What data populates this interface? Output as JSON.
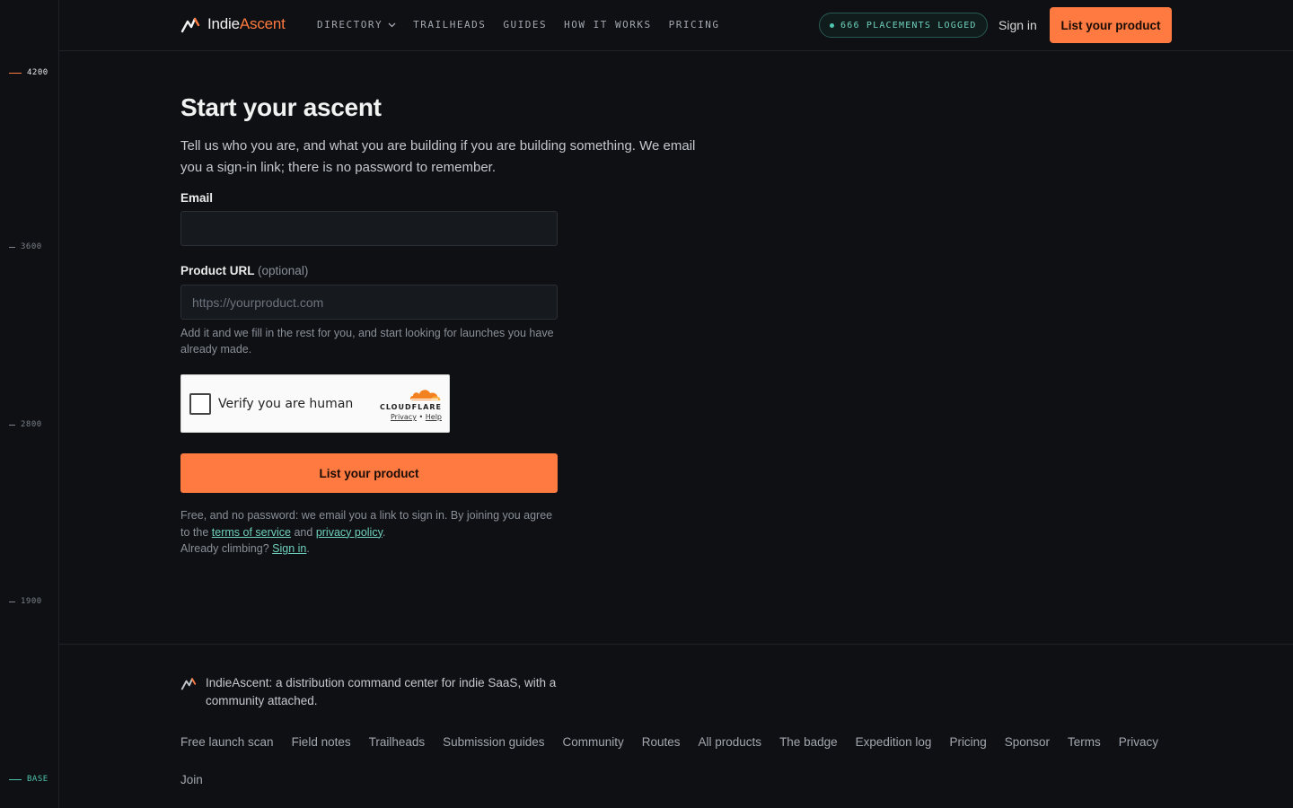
{
  "rail": {
    "marks": [
      "4200",
      "3600",
      "2800",
      "1900",
      "BASE"
    ]
  },
  "header": {
    "brand_part1": "Indie",
    "brand_part2": "Ascent",
    "nav": [
      "DIRECTORY",
      "TRAILHEADS",
      "GUIDES",
      "HOW IT WORKS",
      "PRICING"
    ],
    "placements": "666 PLACEMENTS LOGGED",
    "sign_in": "Sign in",
    "cta": "List your product"
  },
  "main": {
    "title": "Start your ascent",
    "intro": "Tell us who you are, and what you are building if you are building something. We email you a sign-in link; there is no password to remember.",
    "email_label": "Email",
    "email_value": "",
    "url_label": "Product URL",
    "url_optional": "(optional)",
    "url_value": "",
    "url_placeholder": "https://yourproduct.com",
    "url_hint": "Add it and we fill in the rest for you, and start looking for launches you have already made.",
    "captcha_text": "Verify you are human",
    "captcha_brand": "CLOUDFLARE",
    "captcha_privacy": "Privacy",
    "captcha_sep": "•",
    "captcha_help": "Help",
    "submit": "List your product",
    "fine_prefix": "Free, and no password: we email you a link to sign in. By joining you agree to the",
    "terms": "terms of service",
    "and": "and",
    "privacy": "privacy policy",
    "period": ".",
    "already": "Already climbing?",
    "sign_in": "Sign in"
  },
  "footer": {
    "tagline": "IndieAscent: a distribution command center for indie SaaS, with a community attached.",
    "links": [
      "Free launch scan",
      "Field notes",
      "Trailheads",
      "Submission guides",
      "Community",
      "Routes",
      "All products",
      "The badge",
      "Expedition log",
      "Pricing",
      "Sponsor",
      "Terms",
      "Privacy",
      "Join"
    ]
  },
  "colors": {
    "accent": "#ff7a40",
    "teal": "#4fc4b0",
    "background": "#0e1013"
  }
}
